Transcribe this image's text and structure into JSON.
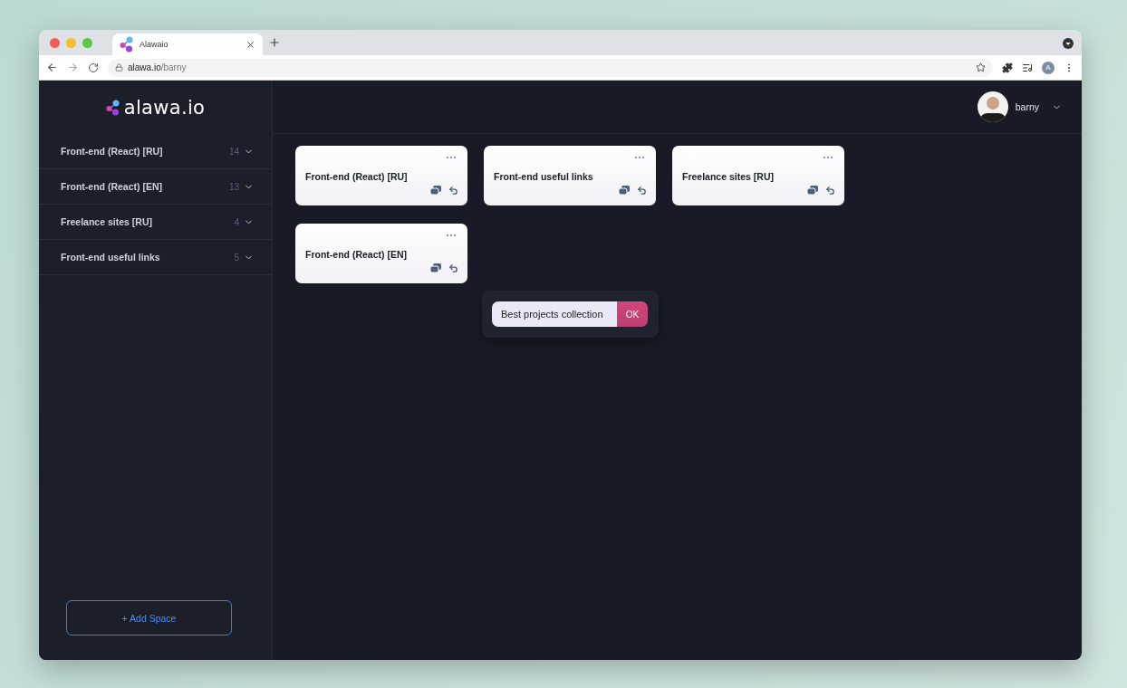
{
  "browser": {
    "tab_title": "Alawaio",
    "url_host": "alawa.io",
    "url_path": "/barny",
    "profile_initial": "A"
  },
  "sidebar": {
    "logo": "alawa.io",
    "spaces": [
      {
        "name": "Front-end (React) [RU]",
        "count": "14"
      },
      {
        "name": "Front-end (React) [EN]",
        "count": "13"
      },
      {
        "name": "Freelance sites [RU]",
        "count": "4"
      },
      {
        "name": "Front-end useful links",
        "count": "5"
      }
    ],
    "add_button": "+ Add Space"
  },
  "header": {
    "user_name": "barny"
  },
  "cards": [
    {
      "title": "Front-end (React) [RU]"
    },
    {
      "title": "Front-end useful links"
    },
    {
      "title": "Freelance sites [RU]"
    },
    {
      "title": "Front-end (React) [EN]"
    }
  ],
  "rename_popup": {
    "value": "Best projects collection",
    "button": "OK"
  }
}
